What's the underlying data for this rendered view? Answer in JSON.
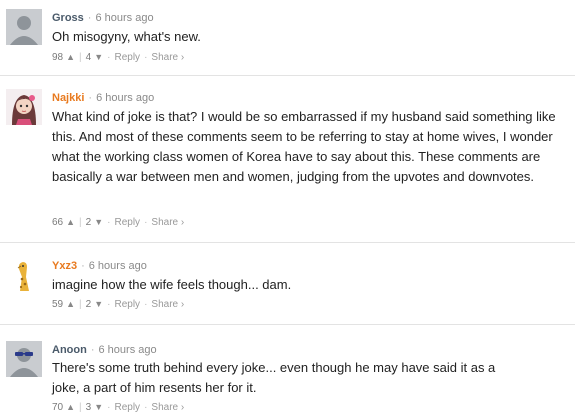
{
  "comments": [
    {
      "author": "Gross",
      "time": "6 hours ago",
      "text": "Oh misogyny, what's new.",
      "upvotes": "98",
      "downvotes": "4",
      "reply": "Reply",
      "share": "Share ›"
    },
    {
      "author": "Najkki",
      "time": "6 hours ago",
      "text": "What kind of joke is that? I would be so embarrassed if my husband said something like this. And most of these comments seem to be referring to stay at home wives, I wonder what the working class women of Korea have to say about this. These comments are basically a war between men and women, judging from the upvotes and downvotes.",
      "upvotes": "66",
      "downvotes": "2",
      "reply": "Reply",
      "share": "Share ›"
    },
    {
      "author": "Yxz3",
      "time": "6 hours ago",
      "text": "imagine how the wife feels though... dam.",
      "upvotes": "59",
      "downvotes": "2",
      "reply": "Reply",
      "share": "Share ›"
    },
    {
      "author": "Anoon",
      "time": "6 hours ago",
      "text": "There's some truth behind every joke... even though he may have said it as a joke, a part of him resents her for it.",
      "upvotes": "70",
      "downvotes": "3",
      "reply": "Reply",
      "share": "Share ›"
    }
  ],
  "colors": {
    "author_default": "#4a5a6a",
    "author_highlight": "#e87a1f",
    "divider": "#e3e3e3"
  }
}
